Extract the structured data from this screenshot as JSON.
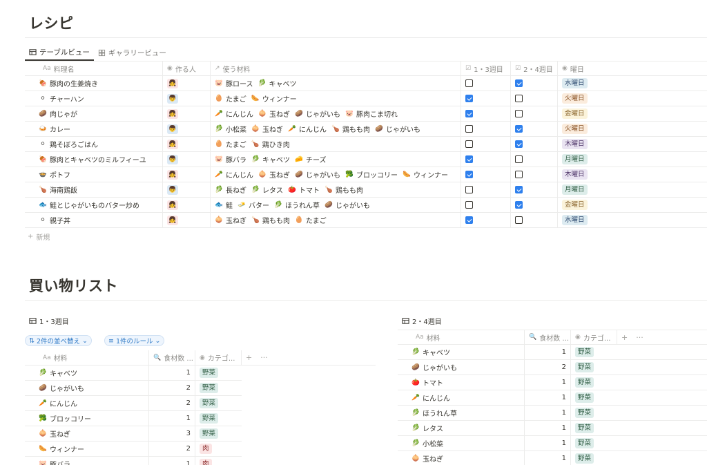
{
  "recipes_title": "レシピ",
  "tabs": [
    {
      "label": "テーブルビュー",
      "icon": "table-icon",
      "active": true
    },
    {
      "label": "ギャラリービュー",
      "icon": "gallery-icon",
      "active": false
    }
  ],
  "recipe_columns": [
    {
      "label": "料理名",
      "icon": "Aa"
    },
    {
      "label": "作る人",
      "icon": "◉"
    },
    {
      "label": "使う材料",
      "icon": "↗"
    },
    {
      "label": "1・3週目",
      "icon": "☑"
    },
    {
      "label": "2・4週目",
      "icon": "☑"
    },
    {
      "label": "曜日",
      "icon": "◉"
    }
  ],
  "recipes": [
    {
      "name": "豚肉の生姜焼き",
      "icon": "🍖",
      "person": "female",
      "ingredients": [
        {
          "e": "🐷",
          "t": "豚ロース"
        },
        {
          "e": "🥬",
          "t": "キャベツ"
        }
      ],
      "w13": false,
      "w24": true,
      "day": "水曜日"
    },
    {
      "name": "チャーハン",
      "icon": "⚪",
      "person": "male",
      "ingredients": [
        {
          "e": "🥚",
          "t": "たまご"
        },
        {
          "e": "🌭",
          "t": "ウィンナー"
        }
      ],
      "w13": true,
      "w24": false,
      "day": "火曜日"
    },
    {
      "name": "肉じゃが",
      "icon": "🥔",
      "person": "female",
      "ingredients": [
        {
          "e": "🥕",
          "t": "にんじん"
        },
        {
          "e": "🧅",
          "t": "玉ねぎ"
        },
        {
          "e": "🥔",
          "t": "じゃがいも"
        },
        {
          "e": "🐷",
          "t": "豚肉こま切れ"
        }
      ],
      "w13": true,
      "w24": false,
      "day": "金曜日"
    },
    {
      "name": "カレー",
      "icon": "🍛",
      "person": "male",
      "ingredients": [
        {
          "e": "🥬",
          "t": "小松菜"
        },
        {
          "e": "🧅",
          "t": "玉ねぎ"
        },
        {
          "e": "🥕",
          "t": "にんじん"
        },
        {
          "e": "🍗",
          "t": "鶏もも肉"
        },
        {
          "e": "🥔",
          "t": "じゃがいも"
        }
      ],
      "w13": false,
      "w24": true,
      "day": "火曜日"
    },
    {
      "name": "鶏そぼろごはん",
      "icon": "⚪",
      "person": "female",
      "ingredients": [
        {
          "e": "🥚",
          "t": "たまご"
        },
        {
          "e": "🍗",
          "t": "鶏ひき肉"
        }
      ],
      "w13": false,
      "w24": true,
      "day": "木曜日"
    },
    {
      "name": "豚肉とキャベツのミルフィーユ",
      "icon": "🍖",
      "person": "male",
      "ingredients": [
        {
          "e": "🐷",
          "t": "豚バラ"
        },
        {
          "e": "🥬",
          "t": "キャベツ"
        },
        {
          "e": "🧀",
          "t": "チーズ"
        }
      ],
      "w13": true,
      "w24": false,
      "day": "月曜日"
    },
    {
      "name": "ポトフ",
      "icon": "🍲",
      "person": "female",
      "ingredients": [
        {
          "e": "🥕",
          "t": "にんじん"
        },
        {
          "e": "🧅",
          "t": "玉ねぎ"
        },
        {
          "e": "🥔",
          "t": "じゃがいも"
        },
        {
          "e": "🥦",
          "t": "ブロッコリー"
        },
        {
          "e": "🌭",
          "t": "ウィンナー"
        }
      ],
      "w13": true,
      "w24": false,
      "day": "木曜日"
    },
    {
      "name": "海南鶏飯",
      "icon": "🍗",
      "person": "male",
      "ingredients": [
        {
          "e": "🥬",
          "t": "長ねぎ"
        },
        {
          "e": "🥬",
          "t": "レタス"
        },
        {
          "e": "🍅",
          "t": "トマト"
        },
        {
          "e": "🍗",
          "t": "鶏もも肉"
        }
      ],
      "w13": false,
      "w24": true,
      "day": "月曜日"
    },
    {
      "name": "鮭とじゃがいものバター炒め",
      "icon": "🐟",
      "person": "female",
      "ingredients": [
        {
          "e": "🐟",
          "t": "鮭"
        },
        {
          "e": "🧈",
          "t": "バター"
        },
        {
          "e": "🥬",
          "t": "ほうれん草"
        },
        {
          "e": "🥔",
          "t": "じゃがいも"
        }
      ],
      "w13": false,
      "w24": true,
      "day": "金曜日"
    },
    {
      "name": "親子丼",
      "icon": "⚪",
      "person": "female",
      "ingredients": [
        {
          "e": "🧅",
          "t": "玉ねぎ"
        },
        {
          "e": "🍗",
          "t": "鶏もも肉"
        },
        {
          "e": "🥚",
          "t": "たまご"
        }
      ],
      "w13": true,
      "w24": false,
      "day": "水曜日"
    }
  ],
  "day_colors": {
    "月曜日": {
      "bg": "#ddedea",
      "fg": "#2b593f"
    },
    "火曜日": {
      "bg": "#fbecdd",
      "fg": "#854c1d"
    },
    "水曜日": {
      "bg": "#ddebf1",
      "fg": "#28456c"
    },
    "木曜日": {
      "bg": "#eae4f2",
      "fg": "#492f64"
    },
    "金曜日": {
      "bg": "#fbf3db",
      "fg": "#89632a"
    }
  },
  "new_label": "新規",
  "shopping_title": "買い物リスト",
  "list13": {
    "title": "1・3週目",
    "sort_label": "2件の並べ替え",
    "filter_label": "1件のルール",
    "columns": [
      {
        "label": "材料",
        "icon": "Aa"
      },
      {
        "label": "食材数 ...",
        "icon": "🔍"
      },
      {
        "label": "カテゴ...",
        "icon": "◉"
      }
    ],
    "rows": [
      {
        "e": "🥬",
        "name": "キャベツ",
        "count": "1",
        "cat": "野菜"
      },
      {
        "e": "🥔",
        "name": "じゃがいも",
        "count": "2",
        "cat": "野菜"
      },
      {
        "e": "🥕",
        "name": "にんじん",
        "count": "2",
        "cat": "野菜"
      },
      {
        "e": "🥦",
        "name": "ブロッコリー",
        "count": "1",
        "cat": "野菜"
      },
      {
        "e": "🧅",
        "name": "玉ねぎ",
        "count": "3",
        "cat": "野菜"
      },
      {
        "e": "🌭",
        "name": "ウィンナー",
        "count": "2",
        "cat": "肉"
      },
      {
        "e": "🐷",
        "name": "豚バラ",
        "count": "1",
        "cat": "肉"
      }
    ]
  },
  "list24": {
    "title": "2・4週目",
    "columns": [
      {
        "label": "材料",
        "icon": "Aa"
      },
      {
        "label": "食材数 ...",
        "icon": "🔍"
      },
      {
        "label": "カテゴ...",
        "icon": "◉"
      }
    ],
    "rows": [
      {
        "e": "🥬",
        "name": "キャベツ",
        "count": "1",
        "cat": "野菜"
      },
      {
        "e": "🥔",
        "name": "じゃがいも",
        "count": "2",
        "cat": "野菜"
      },
      {
        "e": "🍅",
        "name": "トマト",
        "count": "1",
        "cat": "野菜"
      },
      {
        "e": "🥕",
        "name": "にんじん",
        "count": "1",
        "cat": "野菜"
      },
      {
        "e": "🥬",
        "name": "ほうれん草",
        "count": "1",
        "cat": "野菜"
      },
      {
        "e": "🥬",
        "name": "レタス",
        "count": "1",
        "cat": "野菜"
      },
      {
        "e": "🥬",
        "name": "小松菜",
        "count": "1",
        "cat": "野菜"
      },
      {
        "e": "🧅",
        "name": "玉ねぎ",
        "count": "1",
        "cat": "野菜"
      }
    ]
  },
  "cat_colors": {
    "野菜": {
      "bg": "#ddedea",
      "fg": "#2b593f"
    },
    "肉": {
      "bg": "#fbe4e4",
      "fg": "#8a2c2c"
    }
  }
}
